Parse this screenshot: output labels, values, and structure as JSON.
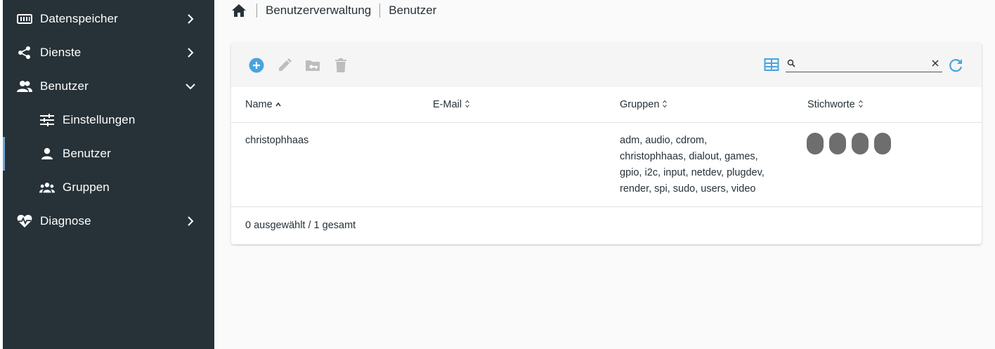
{
  "sidebar": {
    "items": [
      {
        "label": "Datenspeicher",
        "icon": "storage-icon",
        "chevron": "right"
      },
      {
        "label": "Dienste",
        "icon": "share-icon",
        "chevron": "right"
      },
      {
        "label": "Benutzer",
        "icon": "users-icon",
        "chevron": "down"
      },
      {
        "label": "Einstellungen",
        "icon": "tune-icon"
      },
      {
        "label": "Benutzer",
        "icon": "user-icon",
        "active": true
      },
      {
        "label": "Gruppen",
        "icon": "groups-icon"
      },
      {
        "label": "Diagnose",
        "icon": "heart-pulse-icon",
        "chevron": "right"
      }
    ]
  },
  "breadcrumb": {
    "items": [
      "Benutzerverwaltung",
      "Benutzer"
    ]
  },
  "toolbar": {
    "search_value": "",
    "search_placeholder": ""
  },
  "table": {
    "columns": [
      "Name",
      "E-Mail",
      "Gruppen",
      "Stichworte"
    ],
    "sort_indicators": [
      "^",
      "⇕",
      "⇕",
      "⇕"
    ],
    "rows": [
      {
        "name": "christophhaas",
        "email": "",
        "groups_lines": [
          "adm, audio, cdrom,",
          "christophhaas, dialout, games,",
          "gpio, i2c, input, netdev, plugdev,",
          "render, spi, sudo, users, video"
        ],
        "tag_count": 4
      }
    ],
    "footer_selected": "0 ausgewählt",
    "footer_separator": " / ",
    "footer_total": "1 gesamt"
  },
  "colors": {
    "sidebar_bg": "#263238",
    "accent": "#5dade2",
    "active_bar": "#6da8d6",
    "tag": "#6e6e6e"
  }
}
